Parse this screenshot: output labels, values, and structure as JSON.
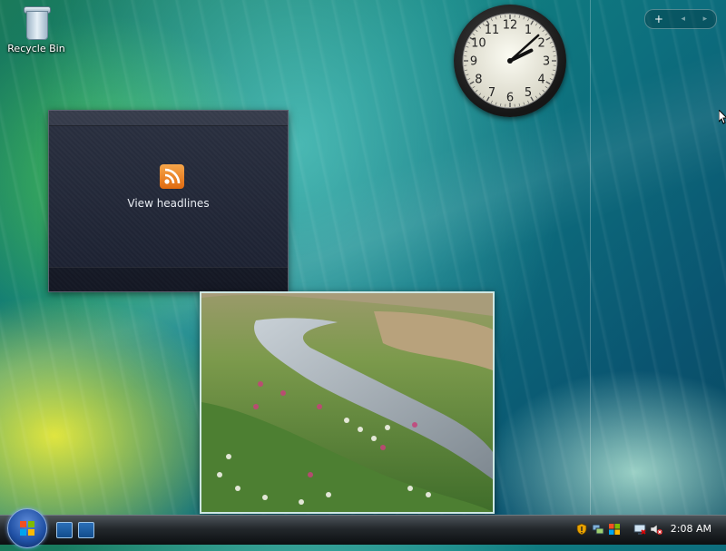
{
  "desktop": {
    "icons": [
      {
        "label": "Recycle Bin",
        "icon": "recycle-bin-icon"
      }
    ]
  },
  "gadgets": {
    "clock": {
      "time_shown": "2:08",
      "hour": 2,
      "minute": 8,
      "numerals": [
        "12",
        "1",
        "2",
        "3",
        "4",
        "5",
        "6",
        "7",
        "8",
        "9",
        "10",
        "11"
      ]
    },
    "feed": {
      "link_label": "View headlines",
      "icon": "rss-icon"
    },
    "slideshow": {
      "icon": "slideshow-image"
    }
  },
  "sidebar": {
    "add_label": "+",
    "prev_label": "◂",
    "next_label": "▸"
  },
  "taskbar": {
    "start_icon": "windows-start-icon",
    "quick_launch": [
      "show-desktop-icon",
      "switch-windows-icon"
    ],
    "tray_icons": [
      "security-alert-icon",
      "network-icon",
      "windows-update-icon",
      "display-icon",
      "volume-muted-icon"
    ],
    "clock": "2:08 AM"
  },
  "colors": {
    "accent": "#1f4fa3",
    "feed_orange": "#e06a10"
  }
}
